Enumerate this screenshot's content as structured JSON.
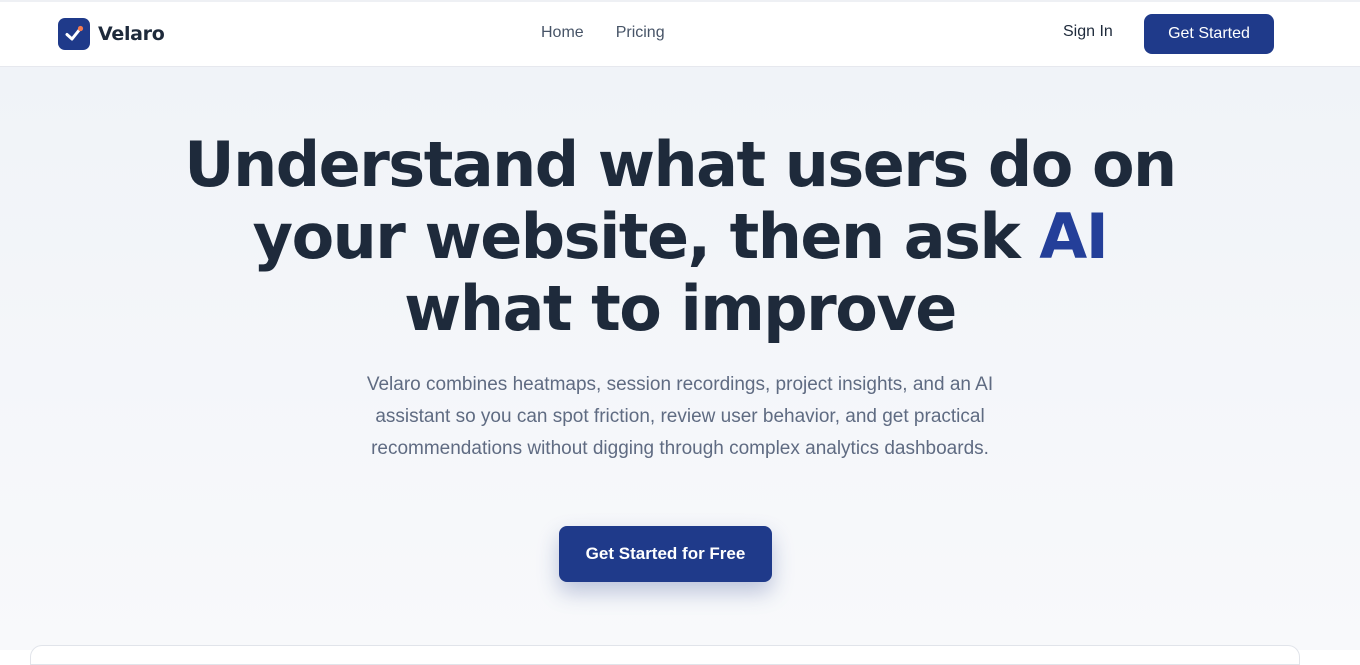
{
  "brand": {
    "name": "Velaro",
    "logo_icon": "checkmark-logo-icon",
    "logo_color": "#1f3a8a"
  },
  "nav": {
    "links": [
      {
        "label": "Home"
      },
      {
        "label": "Pricing"
      }
    ],
    "sign_in_label": "Sign In",
    "get_started_label": "Get Started"
  },
  "hero": {
    "headline_part1": "Understand what users do on your website, then ask ",
    "headline_accent": "AI",
    "headline_part2": " what to improve",
    "subtext": "Velaro combines heatmaps, session recordings, project insights, and an AI assistant so you can spot friction, review user behavior, and get practical recommendations without digging through complex analytics dashboards.",
    "cta_label": "Get Started for Free"
  },
  "colors": {
    "primary": "#1f3a8a",
    "accent_text": "#243f99",
    "heading": "#1e2a3b",
    "body_text": "#5f6b82"
  }
}
